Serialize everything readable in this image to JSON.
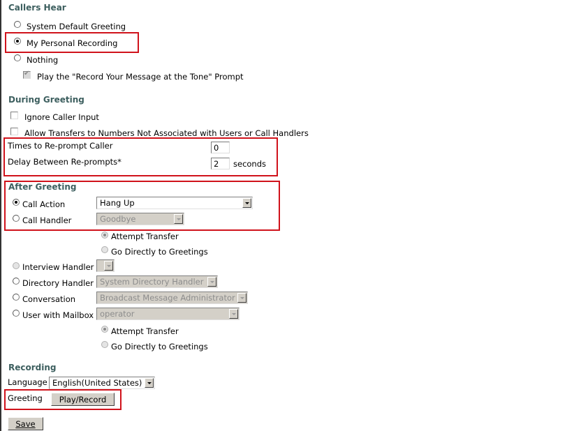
{
  "callers_hear": {
    "heading": "Callers Hear",
    "options": [
      {
        "label": "System Default Greeting",
        "selected": false
      },
      {
        "label": "My Personal Recording",
        "selected": true
      },
      {
        "label": "Nothing",
        "selected": false
      }
    ],
    "play_prompt_label": "Play the \"Record Your Message at the Tone\" Prompt",
    "play_prompt_checked": true,
    "play_prompt_disabled": true
  },
  "during_greeting": {
    "heading": "During Greeting",
    "ignore_input_label": "Ignore Caller Input",
    "allow_transfers_label": "Allow Transfers to Numbers Not Associated with Users or Call Handlers",
    "reprompt_label": "Times to Re-prompt Caller",
    "reprompt_value": "0",
    "delay_label": "Delay Between Re-prompts*",
    "delay_value": "2",
    "delay_unit": "seconds"
  },
  "after_greeting": {
    "heading": "After Greeting",
    "call_action": {
      "label": "Call Action",
      "value": "Hang Up",
      "selected": true
    },
    "call_handler": {
      "label": "Call Handler",
      "value": "Goodbye"
    },
    "handler_transfer": {
      "attempt": "Attempt Transfer",
      "direct": "Go Directly to Greetings"
    },
    "interview_handler": {
      "label": "Interview Handler",
      "value": ""
    },
    "directory_handler": {
      "label": "Directory Handler",
      "value": "System Directory Handler"
    },
    "conversation": {
      "label": "Conversation",
      "value": "Broadcast Message Administrator"
    },
    "user_mailbox": {
      "label": "User with Mailbox",
      "value": "operator"
    },
    "mailbox_transfer": {
      "attempt": "Attempt Transfer",
      "direct": "Go Directly to Greetings"
    }
  },
  "recording": {
    "heading": "Recording",
    "language_label": "Language",
    "language_value": "English(United States)",
    "greeting_label": "Greeting",
    "play_record_label": "Play/Record"
  },
  "save_label": "Save",
  "colors": {
    "heading": "#3d5f5f",
    "highlight": "#d0121b"
  }
}
